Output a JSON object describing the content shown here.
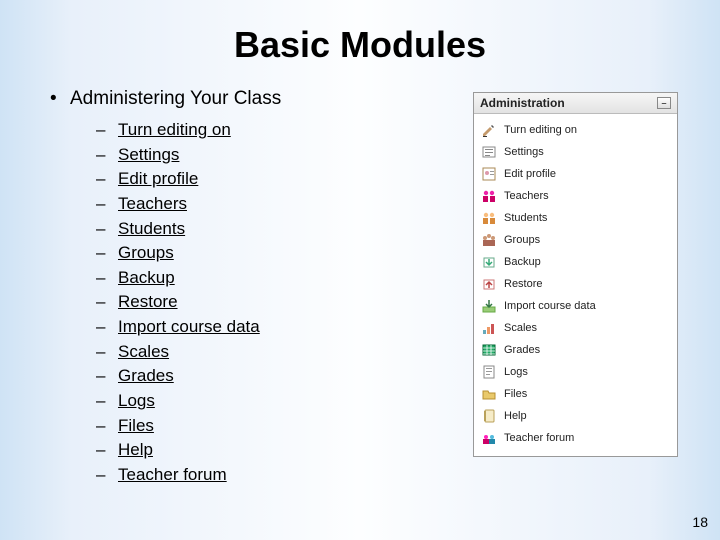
{
  "title": "Basic Modules",
  "section_heading": "Administering Your Class",
  "sub_items": [
    "Turn editing on",
    "Settings",
    "Edit profile",
    "Teachers",
    "Students",
    "Groups",
    "Backup",
    "Restore",
    "Import course data",
    "Scales",
    "Grades",
    "Logs",
    "Files",
    "Help",
    "Teacher forum"
  ],
  "admin_panel": {
    "header": "Administration",
    "items": [
      {
        "label": "Turn editing on",
        "icon": "edit-hand-icon"
      },
      {
        "label": "Settings",
        "icon": "settings-icon"
      },
      {
        "label": "Edit profile",
        "icon": "profile-icon"
      },
      {
        "label": "Teachers",
        "icon": "teachers-icon"
      },
      {
        "label": "Students",
        "icon": "students-icon"
      },
      {
        "label": "Groups",
        "icon": "groups-icon"
      },
      {
        "label": "Backup",
        "icon": "backup-icon"
      },
      {
        "label": "Restore",
        "icon": "restore-icon"
      },
      {
        "label": "Import course data",
        "icon": "import-icon"
      },
      {
        "label": "Scales",
        "icon": "scales-icon"
      },
      {
        "label": "Grades",
        "icon": "grades-icon"
      },
      {
        "label": "Logs",
        "icon": "logs-icon"
      },
      {
        "label": "Files",
        "icon": "files-icon"
      },
      {
        "label": "Help",
        "icon": "help-icon"
      },
      {
        "label": "Teacher forum",
        "icon": "forum-icon"
      }
    ]
  },
  "page_number": "18"
}
